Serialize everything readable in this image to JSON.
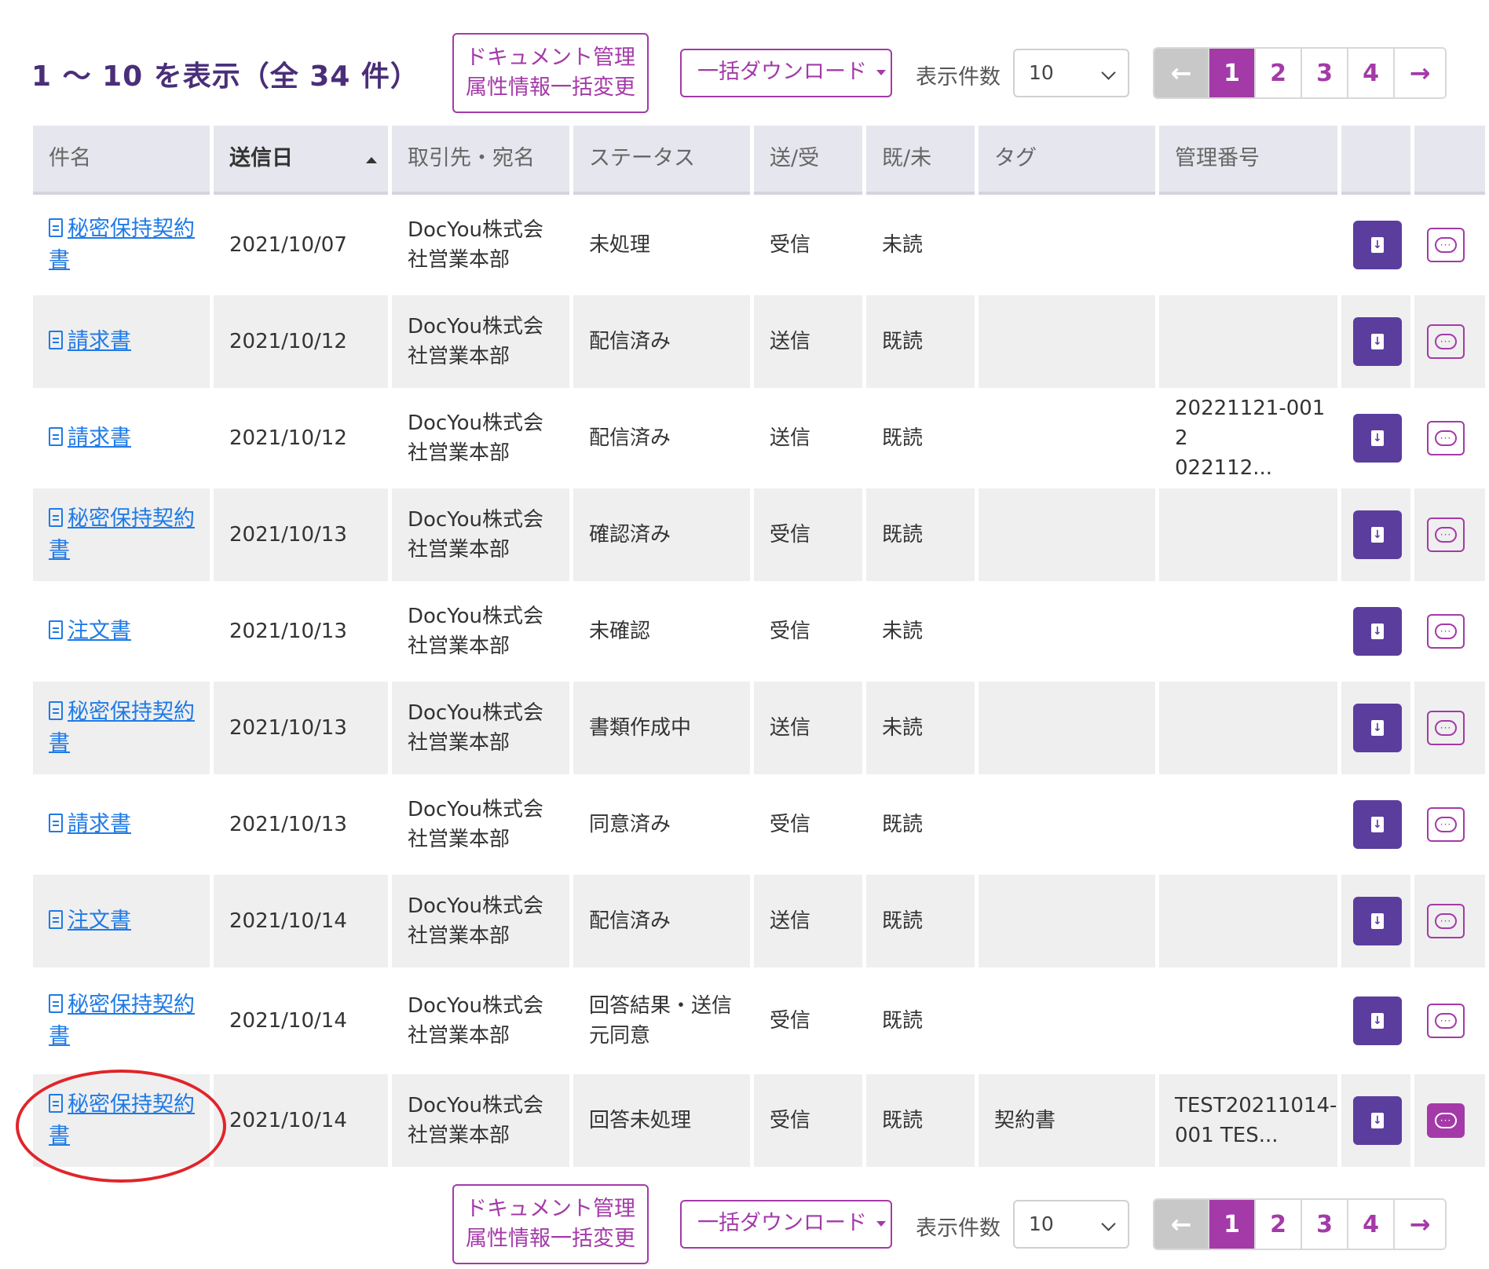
{
  "toolbar": {
    "count_title": "1 ～ 10 を表示（全 34 件）",
    "meta_button_line1": "ドキュメント管理",
    "meta_button_line2": "属性情報一括変更",
    "download_button": "一括ダウンロード",
    "per_page_label": "表示件数",
    "per_page_value": "10",
    "pagination": {
      "prev": "←",
      "pages": [
        "1",
        "2",
        "3",
        "4"
      ],
      "active_page": "1",
      "next": "→"
    }
  },
  "table": {
    "headers": [
      "件名",
      "送信日",
      "取引先・宛名",
      "ステータス",
      "送/受",
      "既/未",
      "タグ",
      "管理番号",
      "",
      ""
    ],
    "sorted_column": "送信日",
    "sort_direction": "asc",
    "rows": [
      {
        "subject_l1": "秘密保持契約",
        "subject_l2": "書",
        "date": "2021/10/07",
        "partner_l1": "DocYou株式会",
        "partner_l2": "社営業本部",
        "status_l1": "未処理",
        "status_l2": "",
        "direction": "受信",
        "read": "未読",
        "tag": "",
        "mgmt_l1": "",
        "mgmt_l2": ""
      },
      {
        "subject_l1": "請求書",
        "subject_l2": "",
        "date": "2021/10/12",
        "partner_l1": "DocYou株式会",
        "partner_l2": "社営業本部",
        "status_l1": "配信済み",
        "status_l2": "",
        "direction": "送信",
        "read": "既読",
        "tag": "",
        "mgmt_l1": "",
        "mgmt_l2": ""
      },
      {
        "subject_l1": "請求書",
        "subject_l2": "",
        "date": "2021/10/12",
        "partner_l1": "DocYou株式会",
        "partner_l2": "社営業本部",
        "status_l1": "配信済み",
        "status_l2": "",
        "direction": "送信",
        "read": "既読",
        "tag": "",
        "mgmt_l1": "20221121-001 2",
        "mgmt_l2": "022112..."
      },
      {
        "subject_l1": "秘密保持契約",
        "subject_l2": "書",
        "date": "2021/10/13",
        "partner_l1": "DocYou株式会",
        "partner_l2": "社営業本部",
        "status_l1": "確認済み",
        "status_l2": "",
        "direction": "受信",
        "read": "既読",
        "tag": "",
        "mgmt_l1": "",
        "mgmt_l2": ""
      },
      {
        "subject_l1": "注文書",
        "subject_l2": "",
        "date": "2021/10/13",
        "partner_l1": "DocYou株式会",
        "partner_l2": "社営業本部",
        "status_l1": "未確認",
        "status_l2": "",
        "direction": "受信",
        "read": "未読",
        "tag": "",
        "mgmt_l1": "",
        "mgmt_l2": ""
      },
      {
        "subject_l1": "秘密保持契約",
        "subject_l2": "書",
        "date": "2021/10/13",
        "partner_l1": "DocYou株式会",
        "partner_l2": "社営業本部",
        "status_l1": "書類作成中",
        "status_l2": "",
        "direction": "送信",
        "read": "未読",
        "tag": "",
        "mgmt_l1": "",
        "mgmt_l2": ""
      },
      {
        "subject_l1": "請求書",
        "subject_l2": "",
        "date": "2021/10/13",
        "partner_l1": "DocYou株式会",
        "partner_l2": "社営業本部",
        "status_l1": "同意済み",
        "status_l2": "",
        "direction": "受信",
        "read": "既読",
        "tag": "",
        "mgmt_l1": "",
        "mgmt_l2": ""
      },
      {
        "subject_l1": "注文書",
        "subject_l2": "",
        "date": "2021/10/14",
        "partner_l1": "DocYou株式会",
        "partner_l2": "社営業本部",
        "status_l1": "配信済み",
        "status_l2": "",
        "direction": "送信",
        "read": "既読",
        "tag": "",
        "mgmt_l1": "",
        "mgmt_l2": ""
      },
      {
        "subject_l1": "秘密保持契約",
        "subject_l2": "書",
        "date": "2021/10/14",
        "partner_l1": "DocYou株式会",
        "partner_l2": "社営業本部",
        "status_l1": "回答結果・送信",
        "status_l2": "元同意",
        "direction": "受信",
        "read": "既読",
        "tag": "",
        "mgmt_l1": "",
        "mgmt_l2": ""
      },
      {
        "subject_l1": "秘密保持契約",
        "subject_l2": "書",
        "date": "2021/10/14",
        "partner_l1": "DocYou株式会",
        "partner_l2": "社営業本部",
        "status_l1": "回答未処理",
        "status_l2": "",
        "direction": "受信",
        "read": "既読",
        "tag": "契約書",
        "mgmt_l1": "TEST20211014-",
        "mgmt_l2": "001 TES..."
      }
    ]
  },
  "icons": {
    "download": "file-download-icon",
    "comment": "comment-icon",
    "doc": "document-icon"
  },
  "colors": {
    "accent": "#a43aa8",
    "title": "#4a2e79",
    "button_dark": "#5b3d9e",
    "link": "#1f7ae6",
    "annotation": "#e0252b"
  }
}
